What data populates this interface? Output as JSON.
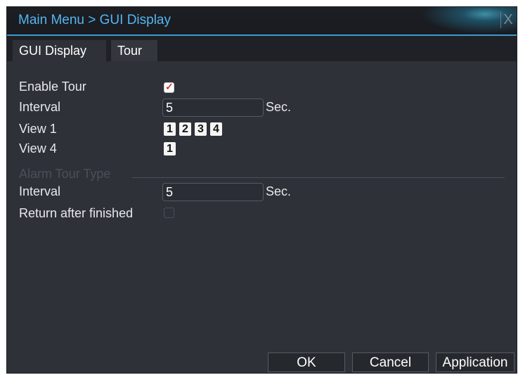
{
  "window": {
    "title": "Main Menu > GUI Display",
    "close_glyph": "X"
  },
  "tabs": [
    {
      "label": "GUI Display",
      "selected": false
    },
    {
      "label": "Tour",
      "selected": true
    }
  ],
  "form": {
    "enable_tour": {
      "label": "Enable Tour",
      "checked": true
    },
    "interval": {
      "label": "Interval",
      "value": "5",
      "unit": "Sec."
    },
    "view_1": {
      "label": "View 1",
      "options": [
        "1",
        "2",
        "3",
        "4"
      ]
    },
    "view_4": {
      "label": "View 4",
      "options": [
        "1"
      ]
    },
    "alarm_section": {
      "title": "Alarm Tour Type"
    },
    "alarm_interval": {
      "label": "Interval",
      "value": "5",
      "unit": "Sec."
    },
    "return_after_finished": {
      "label": "Return after finished",
      "checked": false
    }
  },
  "buttons": {
    "ok": "OK",
    "cancel": "Cancel",
    "application": "Application"
  },
  "colors": {
    "title_blue": "#53b6f0",
    "panel": "#2e3138",
    "check_red": "#d43533"
  }
}
